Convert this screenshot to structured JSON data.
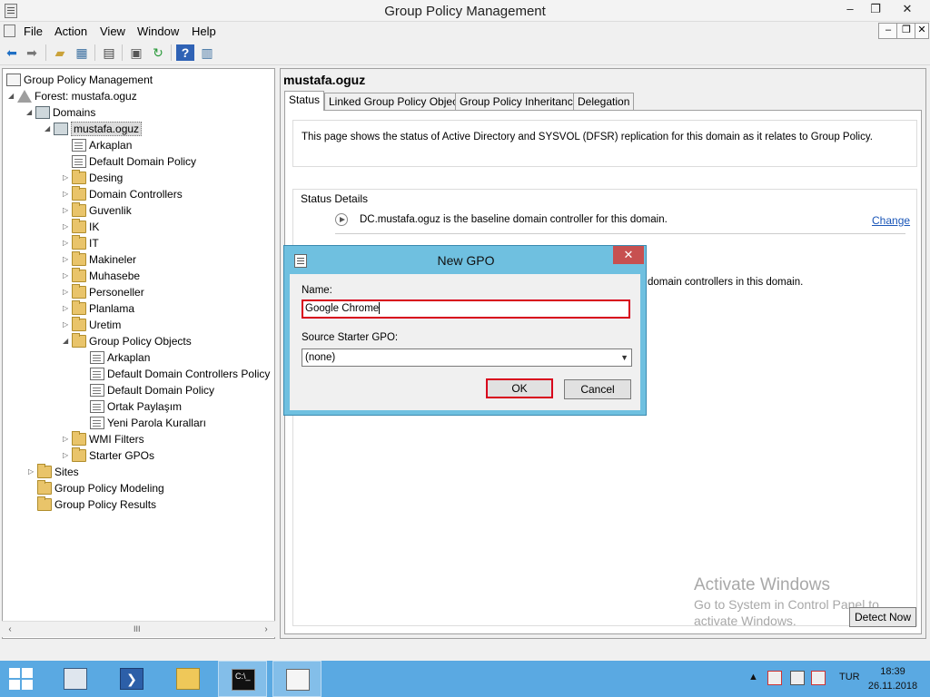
{
  "window": {
    "title": "Group Policy Management",
    "minimize": "‒",
    "restore": "❐",
    "close": "✕",
    "mdi_minimize": "‒",
    "mdi_restore": "❐",
    "mdi_close": "✕"
  },
  "menu": [
    "File",
    "Action",
    "View",
    "Window",
    "Help"
  ],
  "tree": {
    "root": "Group Policy Management",
    "forest": "Forest: mustafa.oguz",
    "domains": "Domains",
    "domain": "mustafa.oguz",
    "domain_children": [
      "Arkaplan",
      "Default Domain Policy",
      "Desing",
      "Domain Controllers",
      "Guvenlik",
      "IK",
      "IT",
      "Makineler",
      "Muhasebe",
      "Personeller",
      "Planlama",
      "Uretim"
    ],
    "gpo_container": "Group Policy Objects",
    "gpo_items": [
      "Arkaplan",
      "Default Domain Controllers Policy",
      "Default Domain Policy",
      "Ortak Paylaşım",
      "Yeni Parola Kuralları"
    ],
    "wmi_filters": "WMI Filters",
    "starter_gpos": "Starter GPOs",
    "sites": "Sites",
    "modeling": "Group Policy Modeling",
    "results": "Group Policy Results",
    "scroll_grip": "III"
  },
  "right_pane": {
    "title": "mustafa.oguz",
    "tabs": [
      "Status",
      "Linked Group Policy Objects",
      "Group Policy Inheritance",
      "Delegation"
    ],
    "active_tab": "Status",
    "info_text": "This page shows the status of Active Directory and SYSVOL (DFSR) replication for this domain as it relates to Group Policy.",
    "status_details_title": "Status Details",
    "baseline_text": "DC.mustafa.oguz is the baseline domain controller for this domain.",
    "change_link": "Change",
    "partial_text": "domain controllers in this domain.",
    "detect_now": "Detect Now"
  },
  "watermark": {
    "line1": "Activate Windows",
    "line2": "Go to System in Control Panel to",
    "line3": "activate Windows."
  },
  "dialog": {
    "title": "New GPO",
    "close": "✕",
    "name_label": "Name:",
    "name_value": "Google Chrome",
    "source_label": "Source Starter GPO:",
    "source_value": "(none)",
    "ok": "OK",
    "cancel": "Cancel"
  },
  "taskbar": {
    "language": "TUR",
    "time": "18:39",
    "date": "26.11.2018",
    "show_hidden": "▲"
  },
  "colors": {
    "accent_red": "#d8001c",
    "dialog_frame": "#6fc0e0",
    "taskbar": "#5aa9e2",
    "link": "#1a56b8"
  }
}
